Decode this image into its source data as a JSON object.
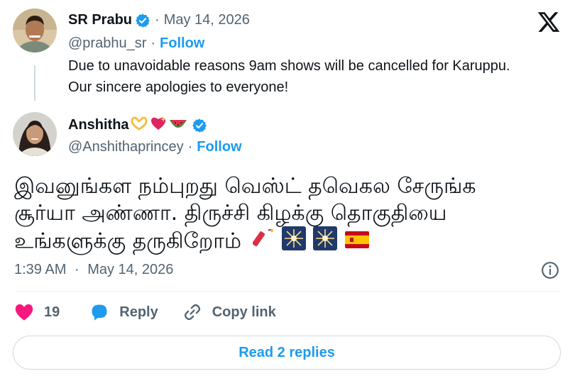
{
  "original": {
    "author_name": "SR Prabu",
    "date": "May 14, 2026",
    "handle": "@prabhu_sr",
    "follow_label": "Follow",
    "text_line1": "Due to unavoidable reasons 9am shows will be cancelled for Karuppu.",
    "text_line2": "Our sincere apologies to everyone!"
  },
  "reply": {
    "author_name": "Anshitha",
    "name_emojis": [
      "heart-hands",
      "sparkling-heart",
      "watermelon"
    ],
    "handle": "@Anshithaprincey",
    "follow_label": "Follow",
    "text_line1": "இவனுங்கள நம்புறது வெஸ்ட் தவெகல சேருங்க",
    "text_line2": "சூர்யா அண்ணா. திருச்சி கிழக்கு தொகுதியை",
    "text_line3": "உங்களுக்கு தருகிறோம்",
    "text_emojis": [
      "firecracker",
      "sparkler",
      "sparkler",
      "spain-flag"
    ],
    "time": "1:39 AM",
    "date": "May 14, 2026"
  },
  "actions": {
    "likes_count": "19",
    "reply_label": "Reply",
    "copy_link_label": "Copy link"
  },
  "read_replies_label": "Read 2 replies",
  "separator": "·",
  "colors": {
    "accent": "#1d9bf0",
    "muted": "#536471",
    "like": "#f91880",
    "border": "#cfd9de"
  },
  "icons": [
    "x-logo-icon",
    "verified-icon",
    "info-icon",
    "heart-icon",
    "reply-bubble-icon",
    "link-icon"
  ]
}
